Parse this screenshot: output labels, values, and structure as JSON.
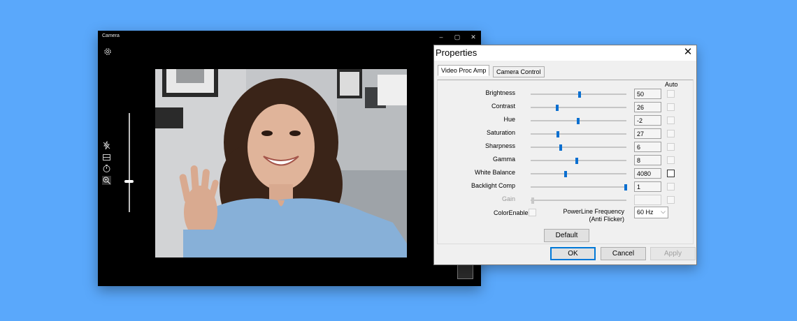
{
  "camera": {
    "title": "Camera",
    "controls": {
      "minimize": "–",
      "maximize": "▢",
      "close": "✕"
    },
    "icons": [
      "settings-icon",
      "flash-off-icon",
      "hdr-icon",
      "timer-icon",
      "zoom-icon"
    ],
    "zoom_level": 0.31
  },
  "dialog": {
    "title": "Properties",
    "close": "✕",
    "tabs": [
      {
        "label": "Video Proc Amp"
      },
      {
        "label": "Camera Control"
      }
    ],
    "auto_header": "Auto",
    "rows": [
      {
        "label": "Brightness",
        "value": "50",
        "position": 0.5,
        "enabled": true
      },
      {
        "label": "Contrast",
        "value": "26",
        "position": 0.26,
        "enabled": true
      },
      {
        "label": "Hue",
        "value": "-2",
        "position": 0.49,
        "enabled": true
      },
      {
        "label": "Saturation",
        "value": "27",
        "position": 0.27,
        "enabled": true
      },
      {
        "label": "Sharpness",
        "value": "6",
        "position": 0.3,
        "enabled": true
      },
      {
        "label": "Gamma",
        "value": "8",
        "position": 0.47,
        "enabled": true
      },
      {
        "label": "White Balance",
        "value": "4080",
        "position": 0.35,
        "enabled": true,
        "auto_dark": true
      },
      {
        "label": "Backlight Comp",
        "value": "1",
        "position": 1.0,
        "enabled": true
      },
      {
        "label": "Gain",
        "value": "",
        "position": 0.0,
        "enabled": false
      }
    ],
    "color_enable_label": "ColorEnable",
    "powerline_label_1": "PowerLine Frequency",
    "powerline_label_2": "(Anti Flicker)",
    "powerline_value": "60 Hz",
    "default_label": "Default",
    "ok_label": "OK",
    "cancel_label": "Cancel",
    "apply_label": "Apply"
  }
}
